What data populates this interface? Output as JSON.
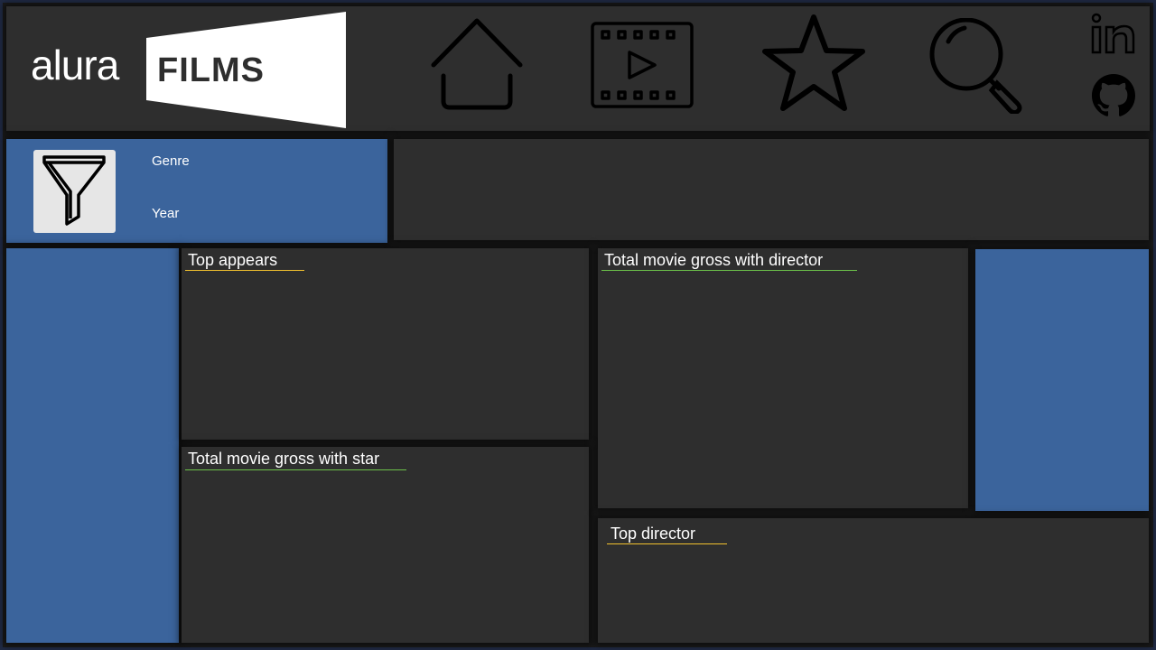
{
  "header": {
    "logo": {
      "brand_text": "alura",
      "product_text": "FILMS"
    },
    "nav_icons": [
      {
        "icon": "home-icon"
      },
      {
        "icon": "video-film-icon"
      },
      {
        "icon": "star-icon"
      },
      {
        "icon": "search-icon"
      }
    ],
    "social_icons": [
      {
        "icon": "linkedin-icon"
      },
      {
        "icon": "github-icon"
      }
    ]
  },
  "filters": {
    "icon": "filter-funnel-icon",
    "genre_label": "Genre",
    "year_label": "Year"
  },
  "visuals": {
    "top_appears": {
      "title": "Top appears",
      "accent": "#f2c12e"
    },
    "gross_with_star": {
      "title": "Total movie gross with star",
      "accent": "#6cc24a"
    },
    "gross_with_director": {
      "title": "Total movie gross with director",
      "accent": "#6cc24a"
    },
    "top_director": {
      "title": "Top director",
      "accent": "#f2c12e"
    }
  },
  "colors": {
    "panel": "#2e2e2e",
    "blue_panel": "#3b649c",
    "background": "#1b1b1b",
    "logo_white": "#ffffff"
  }
}
